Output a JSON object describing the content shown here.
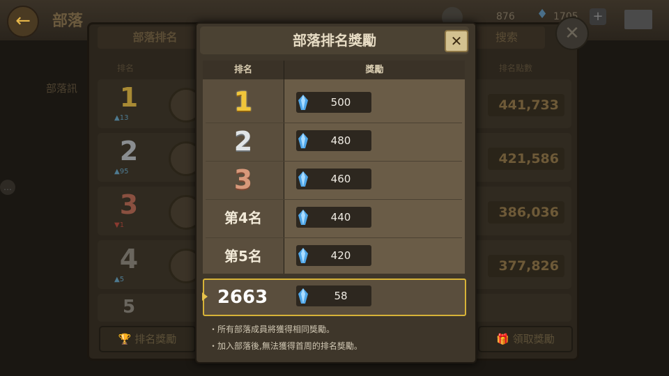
{
  "background": {
    "title": "部落",
    "currency_a": "876",
    "currency_b": "1705",
    "tab_left": "部落排名",
    "tab_right": "搜索",
    "col_rank": "排名",
    "col_score": "排名點數",
    "left_label": "部落訊",
    "rows": [
      {
        "rank": "1",
        "delta": "13",
        "score": "441,733"
      },
      {
        "rank": "2",
        "delta": "95",
        "score": "421,586"
      },
      {
        "rank": "3",
        "delta": "1",
        "score": "386,036"
      },
      {
        "rank": "4",
        "delta": "5",
        "score": "377,826"
      },
      {
        "rank": "5",
        "delta": "",
        "score": ""
      }
    ],
    "btn_rank_reward": "排名獎勵",
    "btn_claim_reward": "領取獎勵"
  },
  "dialog": {
    "title": "部落排名獎勵",
    "col_rank": "排名",
    "col_reward": "獎勵",
    "rows": [
      {
        "rank": "1",
        "reward": "500"
      },
      {
        "rank": "2",
        "reward": "480"
      },
      {
        "rank": "3",
        "reward": "460"
      },
      {
        "rank": "第4名",
        "reward": "440"
      },
      {
        "rank": "第5名",
        "reward": "420"
      }
    ],
    "my_rank": "2663",
    "my_reward": "58",
    "notes": [
      "・所有部落成員將獲得相同獎勵。",
      "・加入部落後,無法獲得首周的排名獎勵。"
    ]
  },
  "colors": {
    "gold": "#f0c63a",
    "silver": "#e0e4e6",
    "bronze": "#d8987a",
    "highlight_border": "#d7b338",
    "gem": "#4fa6e8"
  }
}
